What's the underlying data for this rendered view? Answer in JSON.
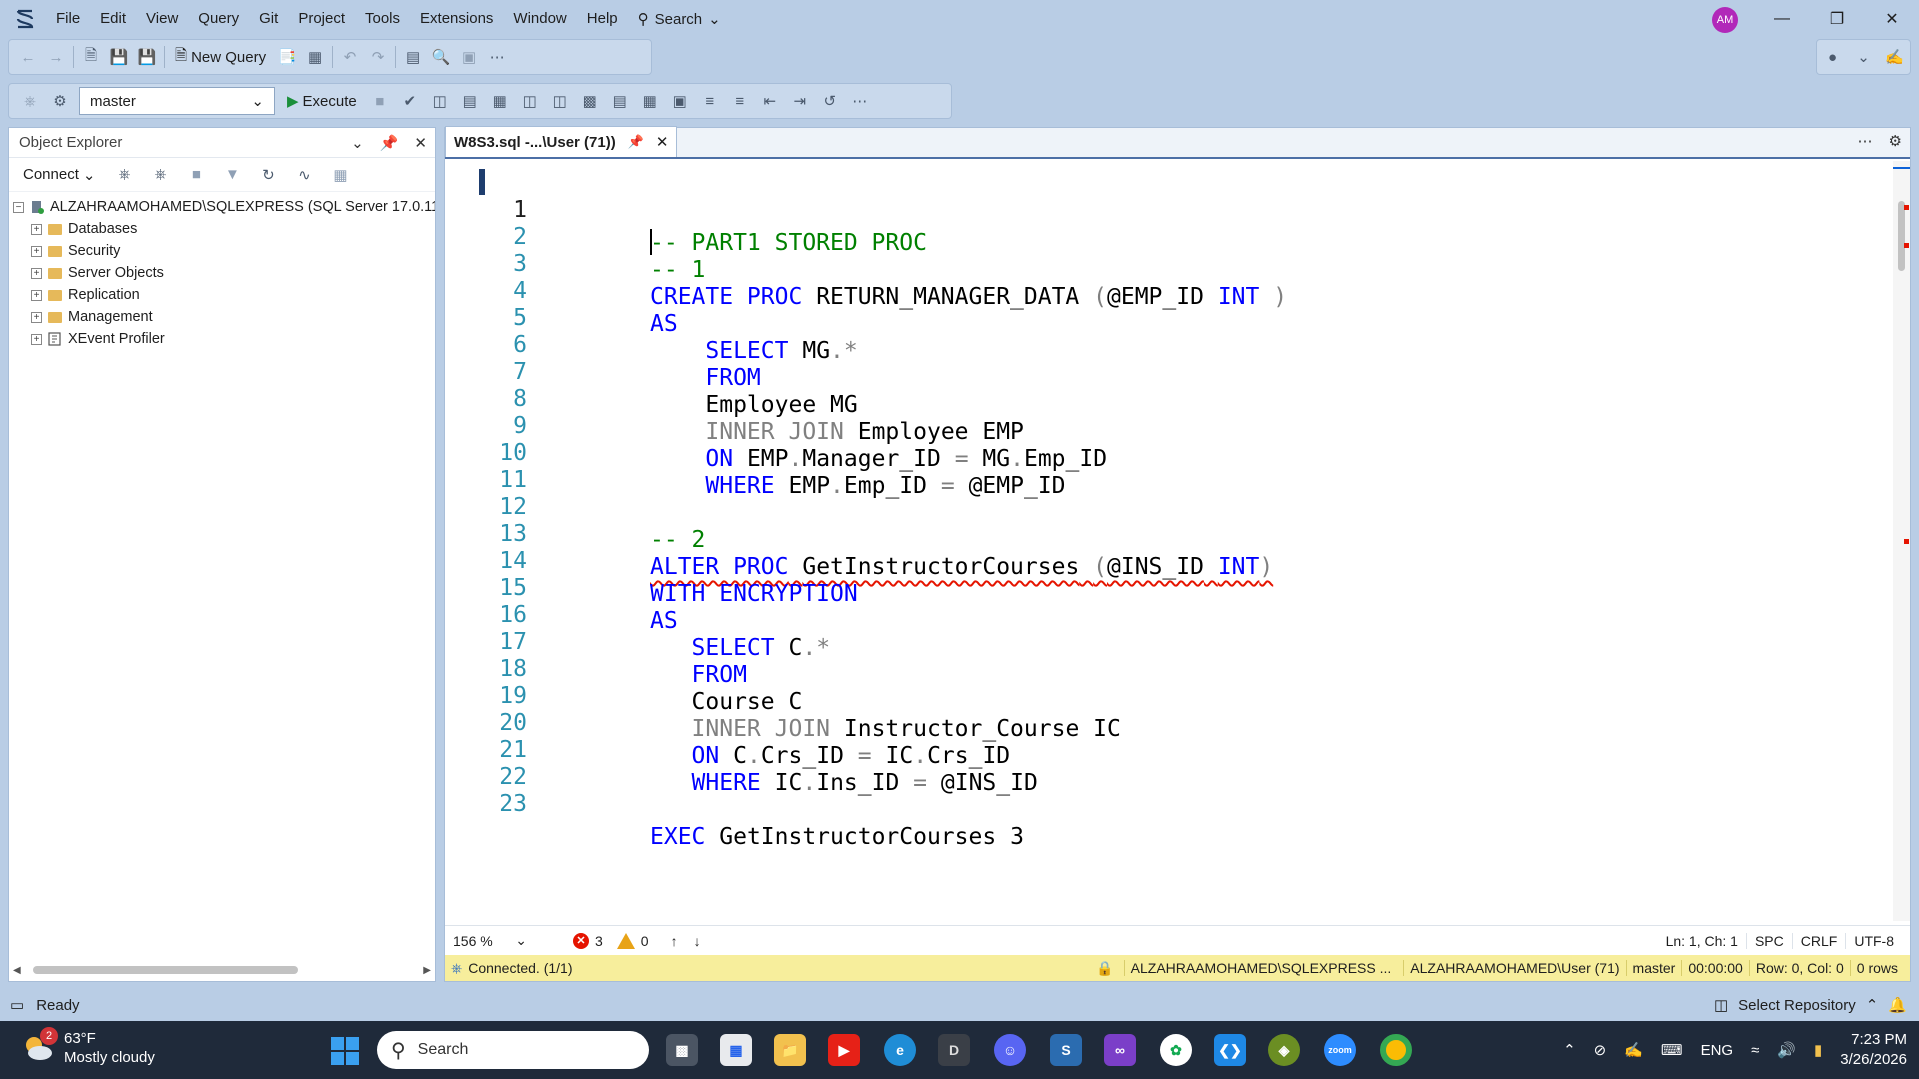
{
  "menu": [
    "File",
    "Edit",
    "View",
    "Query",
    "Git",
    "Project",
    "Tools",
    "Extensions",
    "Window",
    "Help"
  ],
  "search_label": "Search",
  "avatar_initials": "AM",
  "toolbar": {
    "new_query": "New Query",
    "database": "master",
    "execute": "Execute"
  },
  "object_explorer": {
    "title": "Object Explorer",
    "connect": "Connect",
    "server": "ALZAHRAAMOHAMED\\SQLEXPRESS (SQL Server 17.0.110",
    "nodes": [
      "Databases",
      "Security",
      "Server Objects",
      "Replication",
      "Management",
      "XEvent Profiler"
    ]
  },
  "editor": {
    "tab_title": "W8S3.sql -...\\User (71))",
    "lines": [
      "1",
      "2",
      "3",
      "4",
      "5",
      "6",
      "7",
      "8",
      "9",
      "10",
      "11",
      "12",
      "13",
      "14",
      "15",
      "16",
      "17",
      "18",
      "19",
      "20",
      "21",
      "22",
      "23"
    ],
    "code": {
      "l1": "-- PART1 STORED PROC",
      "l2": "-- 1",
      "l3_kw": "CREATE PROC",
      "l3_name": "RETURN_MANAGER_DATA",
      "l3_param": "@EMP_ID",
      "l3_type": "INT",
      "l4": "AS",
      "l5_kw": "SELECT",
      "l5_rest": "MG",
      "l6": "FROM",
      "l7": "Employee MG",
      "l8_kw": "INNER JOIN",
      "l8_rest": "Employee EMP",
      "l9_kw": "ON",
      "l9_a": "EMP",
      "l9_b": "Manager_ID",
      "l9_c": "MG",
      "l9_d": "Emp_ID",
      "l10_kw": "WHERE",
      "l10_a": "EMP",
      "l10_b": "Emp_ID",
      "l10_c": "@EMP_ID",
      "l12": "-- 2",
      "l13_kw": "ALTER PROC",
      "l13_name": "GetInstructorCourses",
      "l13_param": "@INS_ID",
      "l13_type": "INT",
      "l14": "WITH ENCRYPTION",
      "l15": "AS",
      "l16_kw": "SELECT",
      "l16_rest": "C",
      "l17": "FROM",
      "l18": "Course C",
      "l19_kw": "INNER JOIN",
      "l19_rest": "Instructor_Course IC",
      "l20_kw": "ON",
      "l20_a": "C",
      "l20_b": "Crs_ID",
      "l20_c": "IC",
      "l20_d": "Crs_ID",
      "l21_kw": "WHERE",
      "l21_a": "IC",
      "l21_b": "Ins_ID",
      "l21_c": "@INS_ID",
      "l23_kw": "EXEC",
      "l23_name": "GetInstructorCourses",
      "l23_arg": "3"
    },
    "zoom": "156 %",
    "errors": "3",
    "warnings": "0",
    "position": "Ln: 1, Ch: 1",
    "whitespace": "SPC",
    "line_ending": "CRLF",
    "encoding": "UTF-8"
  },
  "connection": {
    "status": "Connected. (1/1)",
    "server": "ALZAHRAAMOHAMED\\SQLEXPRESS ...",
    "user": "ALZAHRAAMOHAMED\\User (71)",
    "database": "master",
    "elapsed": "00:00:00",
    "rowcol": "Row: 0, Col: 0",
    "rows": "0 rows"
  },
  "statusbar": {
    "ready": "Ready",
    "select_repo": "Select Repository"
  },
  "taskbar": {
    "temp": "63°F",
    "weather": "Mostly cloudy",
    "weather_badge": "2",
    "search": "Search",
    "lang": "ENG",
    "time": "7:23 PM",
    "date": "3/26/2026"
  }
}
